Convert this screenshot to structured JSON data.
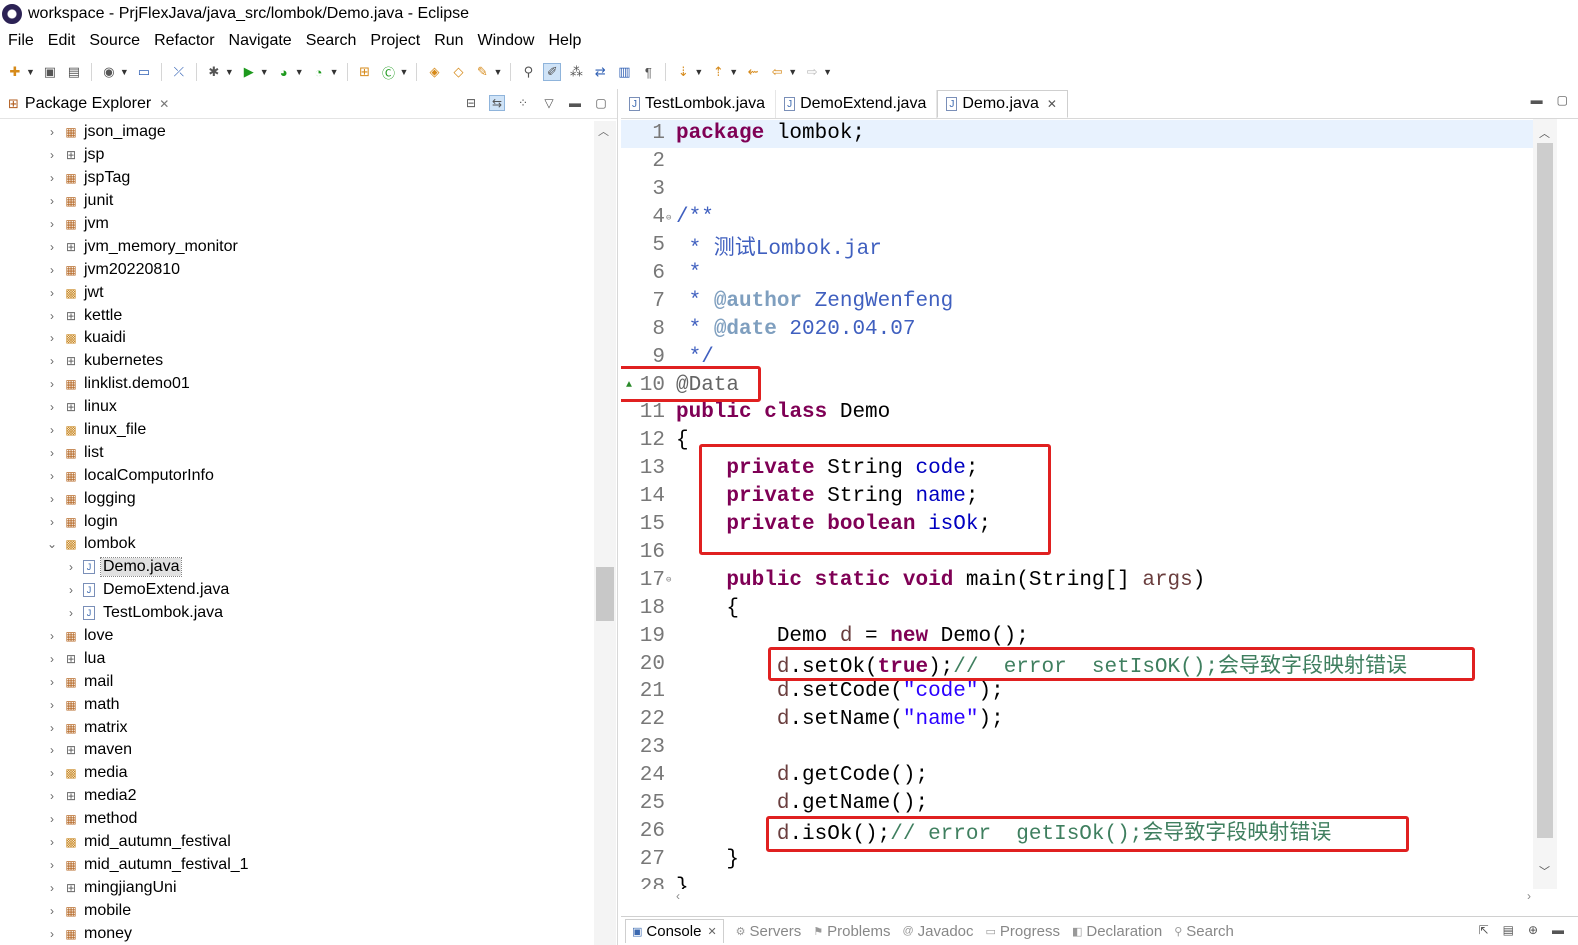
{
  "window": {
    "title": "workspace - PrjFlexJava/java_src/lombok/Demo.java - Eclipse"
  },
  "menu": [
    "File",
    "Edit",
    "Source",
    "Refactor",
    "Navigate",
    "Search",
    "Project",
    "Run",
    "Window",
    "Help"
  ],
  "package_explorer": {
    "title": "Package Explorer",
    "items": [
      {
        "label": "json_image",
        "icon": "package-icon",
        "level": 0,
        "expanded": false
      },
      {
        "label": "jsp",
        "icon": "empty-package-icon",
        "level": 0,
        "expanded": false
      },
      {
        "label": "jspTag",
        "icon": "package-icon",
        "level": 0,
        "expanded": false
      },
      {
        "label": "junit",
        "icon": "package-icon",
        "level": 0,
        "expanded": false
      },
      {
        "label": "jvm",
        "icon": "package-icon",
        "level": 0,
        "expanded": false
      },
      {
        "label": "jvm_memory_monitor",
        "icon": "empty-package-icon",
        "level": 0,
        "expanded": false
      },
      {
        "label": "jvm20220810",
        "icon": "package-icon",
        "level": 0,
        "expanded": false
      },
      {
        "label": "jwt",
        "icon": "java-package-icon",
        "level": 0,
        "expanded": false
      },
      {
        "label": "kettle",
        "icon": "empty-package-icon",
        "level": 0,
        "expanded": false
      },
      {
        "label": "kuaidi",
        "icon": "java-package-icon",
        "level": 0,
        "expanded": false
      },
      {
        "label": "kubernetes",
        "icon": "empty-package-icon",
        "level": 0,
        "expanded": false
      },
      {
        "label": "linklist.demo01",
        "icon": "package-icon",
        "level": 0,
        "expanded": false
      },
      {
        "label": "linux",
        "icon": "empty-package-icon",
        "level": 0,
        "expanded": false
      },
      {
        "label": "linux_file",
        "icon": "java-package-icon",
        "level": 0,
        "expanded": false
      },
      {
        "label": "list",
        "icon": "package-icon",
        "level": 0,
        "expanded": false
      },
      {
        "label": "localComputorInfo",
        "icon": "package-icon",
        "level": 0,
        "expanded": false
      },
      {
        "label": "logging",
        "icon": "package-icon",
        "level": 0,
        "expanded": false
      },
      {
        "label": "login",
        "icon": "package-icon",
        "level": 0,
        "expanded": false
      },
      {
        "label": "lombok",
        "icon": "java-package-icon",
        "level": 0,
        "expanded": true
      },
      {
        "label": "Demo.java",
        "icon": "java-file-icon",
        "level": 1,
        "expanded": false,
        "selected": true
      },
      {
        "label": "DemoExtend.java",
        "icon": "java-file-icon",
        "level": 1,
        "expanded": false
      },
      {
        "label": "TestLombok.java",
        "icon": "java-file-icon",
        "level": 1,
        "expanded": false
      },
      {
        "label": "love",
        "icon": "package-icon",
        "level": 0,
        "expanded": false
      },
      {
        "label": "lua",
        "icon": "empty-package-icon",
        "level": 0,
        "expanded": false
      },
      {
        "label": "mail",
        "icon": "package-icon",
        "level": 0,
        "expanded": false
      },
      {
        "label": "math",
        "icon": "package-icon",
        "level": 0,
        "expanded": false
      },
      {
        "label": "matrix",
        "icon": "package-icon",
        "level": 0,
        "expanded": false
      },
      {
        "label": "maven",
        "icon": "empty-package-icon",
        "level": 0,
        "expanded": false
      },
      {
        "label": "media",
        "icon": "java-package-icon",
        "level": 0,
        "expanded": false
      },
      {
        "label": "media2",
        "icon": "empty-package-icon",
        "level": 0,
        "expanded": false
      },
      {
        "label": "method",
        "icon": "package-icon",
        "level": 0,
        "expanded": false
      },
      {
        "label": "mid_autumn_festival",
        "icon": "java-package-icon",
        "level": 0,
        "expanded": false
      },
      {
        "label": "mid_autumn_festival_1",
        "icon": "package-icon",
        "level": 0,
        "expanded": false
      },
      {
        "label": "mingjiangUni",
        "icon": "empty-package-icon",
        "level": 0,
        "expanded": false
      },
      {
        "label": "mobile",
        "icon": "package-icon",
        "level": 0,
        "expanded": false
      },
      {
        "label": "money",
        "icon": "package-icon",
        "level": 0,
        "expanded": false
      }
    ]
  },
  "editor": {
    "tabs": [
      {
        "label": "TestLombok.java",
        "active": false
      },
      {
        "label": "DemoExtend.java",
        "active": false
      },
      {
        "label": "Demo.java",
        "active": true
      }
    ],
    "lines": [
      {
        "n": "1",
        "tokens": [
          [
            "kw",
            "package"
          ],
          [
            "pl",
            " lombok;"
          ]
        ],
        "current": true
      },
      {
        "n": "2",
        "tokens": []
      },
      {
        "n": "3",
        "tokens": []
      },
      {
        "n": "4",
        "fold": true,
        "tokens": [
          [
            "cm",
            "/**"
          ]
        ]
      },
      {
        "n": "5",
        "tokens": [
          [
            "cm",
            " * 测试Lombok.jar"
          ]
        ]
      },
      {
        "n": "6",
        "tokens": [
          [
            "cm",
            " *"
          ]
        ]
      },
      {
        "n": "7",
        "tokens": [
          [
            "cm",
            " * "
          ],
          [
            "tag",
            "@author"
          ],
          [
            "cm",
            " ZengWenfeng"
          ]
        ]
      },
      {
        "n": "8",
        "tokens": [
          [
            "cm",
            " * "
          ],
          [
            "tag",
            "@date"
          ],
          [
            "cm",
            " 2020.04.07"
          ]
        ]
      },
      {
        "n": "9",
        "tokens": [
          [
            "cm",
            " */"
          ]
        ]
      },
      {
        "n": "10",
        "warn": true,
        "tokens": [
          [
            "ann",
            "@Data"
          ]
        ]
      },
      {
        "n": "11",
        "tokens": [
          [
            "kw",
            "public"
          ],
          [
            "pl",
            " "
          ],
          [
            "kw",
            "class"
          ],
          [
            "pl",
            " Demo"
          ]
        ]
      },
      {
        "n": "12",
        "tokens": [
          [
            "pl",
            "{"
          ]
        ]
      },
      {
        "n": "13",
        "tokens": [
          [
            "pl",
            "    "
          ],
          [
            "kw",
            "private"
          ],
          [
            "pl",
            " String "
          ],
          [
            "fld",
            "code"
          ],
          [
            "pl",
            ";"
          ]
        ]
      },
      {
        "n": "14",
        "tokens": [
          [
            "pl",
            "    "
          ],
          [
            "kw",
            "private"
          ],
          [
            "pl",
            " String "
          ],
          [
            "fld",
            "name"
          ],
          [
            "pl",
            ";"
          ]
        ]
      },
      {
        "n": "15",
        "tokens": [
          [
            "pl",
            "    "
          ],
          [
            "kw",
            "private"
          ],
          [
            "pl",
            " "
          ],
          [
            "kw",
            "boolean"
          ],
          [
            "pl",
            " "
          ],
          [
            "fld",
            "isOk"
          ],
          [
            "pl",
            ";"
          ]
        ]
      },
      {
        "n": "16",
        "tokens": []
      },
      {
        "n": "17",
        "fold": true,
        "tokens": [
          [
            "pl",
            "    "
          ],
          [
            "kw",
            "public"
          ],
          [
            "pl",
            " "
          ],
          [
            "kw",
            "static"
          ],
          [
            "pl",
            " "
          ],
          [
            "kw",
            "void"
          ],
          [
            "pl",
            " main(String[] "
          ],
          [
            "par",
            "args"
          ],
          [
            "pl",
            ")"
          ]
        ]
      },
      {
        "n": "18",
        "tokens": [
          [
            "pl",
            "    {"
          ]
        ]
      },
      {
        "n": "19",
        "tokens": [
          [
            "pl",
            "        Demo "
          ],
          [
            "par",
            "d"
          ],
          [
            "pl",
            " = "
          ],
          [
            "kw",
            "new"
          ],
          [
            "pl",
            " Demo();"
          ]
        ]
      },
      {
        "n": "20",
        "tokens": [
          [
            "pl",
            "        "
          ],
          [
            "par",
            "d"
          ],
          [
            "pl",
            ".setOk("
          ],
          [
            "kw",
            "true"
          ],
          [
            "pl",
            ");"
          ],
          [
            "lc",
            "//  error  setIsOK();会导致字段映射错误"
          ]
        ]
      },
      {
        "n": "21",
        "tokens": [
          [
            "pl",
            "        "
          ],
          [
            "par",
            "d"
          ],
          [
            "pl",
            ".setCode("
          ],
          [
            "str",
            "\"code\""
          ],
          [
            "pl",
            ");"
          ]
        ]
      },
      {
        "n": "22",
        "tokens": [
          [
            "pl",
            "        "
          ],
          [
            "par",
            "d"
          ],
          [
            "pl",
            ".setName("
          ],
          [
            "str",
            "\"name\""
          ],
          [
            "pl",
            ");"
          ]
        ]
      },
      {
        "n": "23",
        "tokens": []
      },
      {
        "n": "24",
        "tokens": [
          [
            "pl",
            "        "
          ],
          [
            "par",
            "d"
          ],
          [
            "pl",
            ".getCode();"
          ]
        ]
      },
      {
        "n": "25",
        "tokens": [
          [
            "pl",
            "        "
          ],
          [
            "par",
            "d"
          ],
          [
            "pl",
            ".getName();"
          ]
        ]
      },
      {
        "n": "26",
        "tokens": [
          [
            "pl",
            "        "
          ],
          [
            "par",
            "d"
          ],
          [
            "pl",
            ".isOk();"
          ],
          [
            "lc",
            "// error  getIsOk();会导致字段映射错误"
          ]
        ]
      },
      {
        "n": "27",
        "tokens": [
          [
            "pl",
            "    }"
          ]
        ]
      },
      {
        "n": "28",
        "tokens": [
          [
            "pl",
            "}"
          ]
        ]
      }
    ]
  },
  "bottom_tabs": [
    {
      "label": "Console",
      "active": true,
      "icon": "console-icon"
    },
    {
      "label": "Servers",
      "active": false,
      "icon": "servers-icon"
    },
    {
      "label": "Problems",
      "active": false,
      "icon": "problems-icon"
    },
    {
      "label": "Javadoc",
      "active": false,
      "icon": "javadoc-icon"
    },
    {
      "label": "Progress",
      "active": false,
      "icon": "progress-icon"
    },
    {
      "label": "Declaration",
      "active": false,
      "icon": "declaration-icon"
    },
    {
      "label": "Search",
      "active": false,
      "icon": "search-icon"
    }
  ],
  "colors": {
    "keyword": "#7f0055",
    "comment": "#3f5fbf",
    "line_comment": "#3f7f5f",
    "string": "#2a00ff",
    "field": "#0000c0",
    "annotation": "#646464",
    "highlight_box": "#e02020",
    "current_line": "#e8f2fe"
  }
}
